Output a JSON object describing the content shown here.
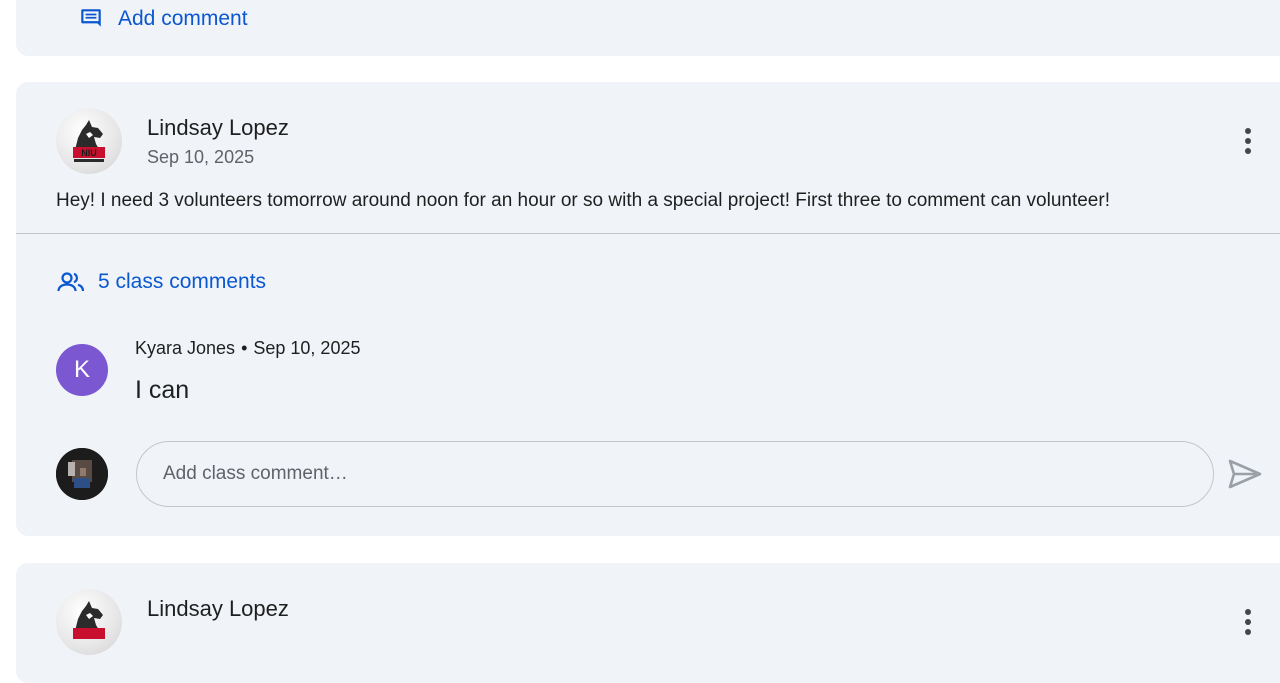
{
  "top_card": {
    "add_comment_label": "Add comment"
  },
  "post": {
    "author": "Lindsay Lopez",
    "date": "Sep 10, 2025",
    "body": "Hey!  I need 3 volunteers tomorrow around noon for an hour or so with a special project!  First three to comment can volunteer!",
    "class_comments_label": "5 class comments",
    "comments": [
      {
        "avatar_letter": "K",
        "author": "Kyara Jones",
        "separator": "•",
        "date": "Sep 10, 2025",
        "text": "I can"
      }
    ],
    "comment_input": {
      "placeholder": "Add class comment…",
      "value": ""
    }
  },
  "next_post": {
    "author": "Lindsay Lopez"
  },
  "colors": {
    "accent": "#0b57d0",
    "card_background": "#f0f4f9",
    "avatar_k": "#7b57d1"
  },
  "icons": {
    "add_comment": "comment-icon",
    "class_comments": "people-icon",
    "more": "more-vert-icon",
    "send": "send-icon"
  }
}
